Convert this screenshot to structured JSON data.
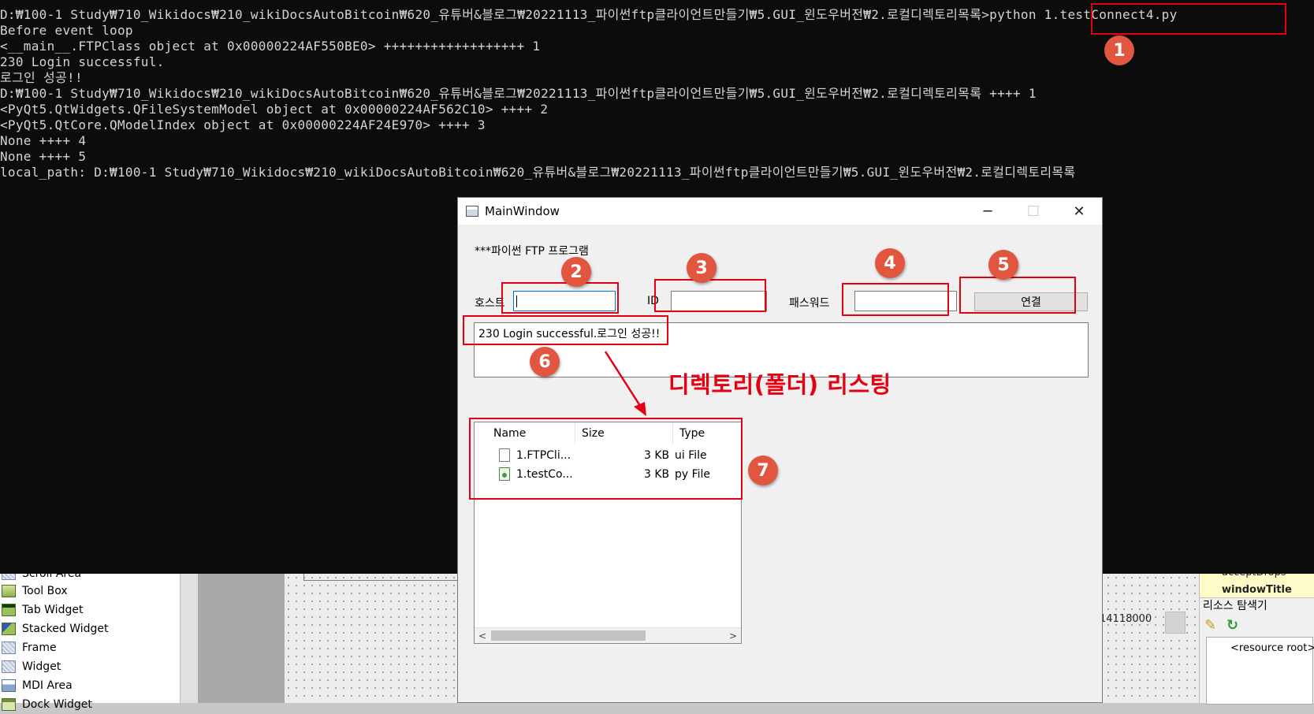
{
  "console": {
    "lines": [
      "D:₩100-1 Study₩710_Wikidocs₩210_wikiDocsAutoBitcoin₩620_유튜버&블로그₩20221113_파이썬ftp클라이언트만들기₩5.GUI_윈도우버전₩2.로컬디렉토리목록>python 1.testConnect4.py",
      "Before event loop",
      "<__main__.FTPClass object at 0x00000224AF550BE0> ++++++++++++++++++ 1",
      "230 Login successful.",
      "로그인 성공!!",
      "D:₩100-1 Study₩710_Wikidocs₩210_wikiDocsAutoBitcoin₩620_유튜버&블로그₩20221113_파이썬ftp클라이언트만들기₩5.GUI_윈도우버전₩2.로컬디렉토리목록 ++++ 1",
      "<PyQt5.QtWidgets.QFileSystemModel object at 0x00000224AF562C10> ++++ 2",
      "<PyQt5.QtCore.QModelIndex object at 0x00000224AF24E970> ++++ 3",
      "None ++++ 4",
      "None ++++ 5",
      "local_path: D:₩100-1 Study₩710_Wikidocs₩210_wikiDocsAutoBitcoin₩620_유튜버&블로그₩20221113_파이썬ftp클라이언트만들기₩5.GUI_윈도우버전₩2.로컬디렉토리목록"
    ],
    "text_color": "#d4d4d4",
    "background": "#0c0c0c"
  },
  "main_window": {
    "title": "MainWindow",
    "minimize_glyph": "─",
    "maximize_glyph": "☐",
    "close_glyph": "✕",
    "heading": "***파이썬 FTP 프로그램",
    "host_label": "호스트",
    "host_value": "",
    "id_label": "ID",
    "id_value": "",
    "password_label": "패스워드",
    "password_value": "",
    "connect_button": "연결",
    "log_text": "230 Login successful.로그인 성공!!",
    "tree": {
      "headers": [
        "Name",
        "Size",
        "Type"
      ],
      "rows": [
        {
          "name": "1.FTPCli...",
          "size": "3 KB",
          "type": "ui File",
          "icon": "ui-file-icon"
        },
        {
          "name": "1.testCo...",
          "size": "3 KB",
          "type": "py File",
          "icon": "py-file-icon"
        }
      ],
      "scroll_left": "<",
      "scroll_right": ">"
    }
  },
  "annotations": {
    "badges": [
      "1",
      "2",
      "3",
      "4",
      "5",
      "6",
      "7"
    ],
    "caption": "디렉토리(폴더) 리스팅",
    "color": "#e60012",
    "badge_color": "#e2563f"
  },
  "designer": {
    "widget_box": [
      {
        "label": "Scroll Area",
        "icon": "scroll-area-icon"
      },
      {
        "label": "Tool Box",
        "icon": "tool-box-icon"
      },
      {
        "label": "Tab Widget",
        "icon": "tab-widget-icon"
      },
      {
        "label": "Stacked Widget",
        "icon": "stacked-widget-icon"
      },
      {
        "label": "Frame",
        "icon": "frame-icon"
      },
      {
        "label": "Widget",
        "icon": "widget-icon"
      },
      {
        "label": "MDI Area",
        "icon": "mdi-area-icon"
      },
      {
        "label": "Dock Widget",
        "icon": "dock-widget-icon"
      }
    ],
    "number_fragment": "14118000",
    "property_fragments": [
      "acceptDrops",
      "windowTitle"
    ],
    "resource_browser_title": "리소스 탐색기",
    "resource_root": "<resource root>"
  }
}
